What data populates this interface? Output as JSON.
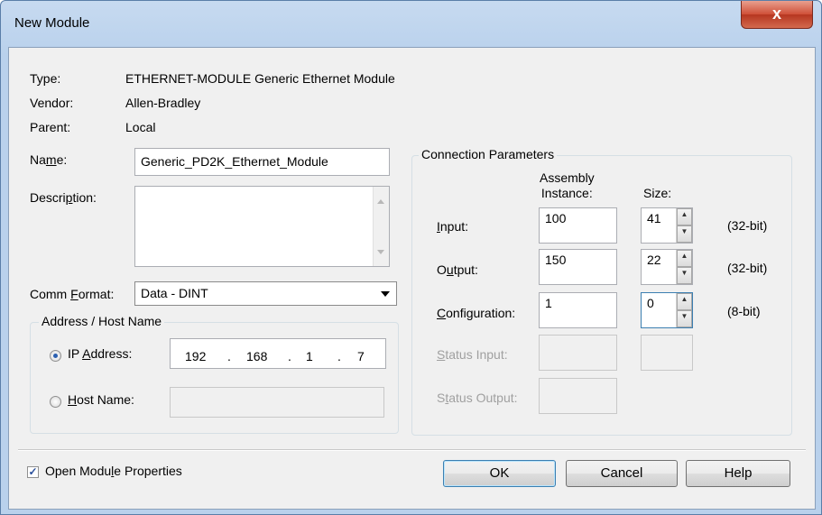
{
  "window": {
    "title": "New Module",
    "close_glyph": "x"
  },
  "fields": {
    "type_label": "Type:",
    "type_value": "ETHERNET-MODULE Generic Ethernet Module",
    "vendor_label": "Vendor:",
    "vendor_value": "Allen-Bradley",
    "parent_label": "Parent:",
    "parent_value": "Local",
    "name_label_pre": "Na",
    "name_label_u": "m",
    "name_label_post": "e:",
    "name_value": "Generic_PD2K_Ethernet_Module",
    "description_label_pre": "Descri",
    "description_label_u": "p",
    "description_label_post": "tion:",
    "description_value": "",
    "comm_format_label_pre": "Comm ",
    "comm_format_label_u": "F",
    "comm_format_label_post": "ormat:",
    "comm_format_value": "Data - DINT"
  },
  "address": {
    "group_title": "Address / Host Name",
    "ip_label_pre": "IP ",
    "ip_label_u": "A",
    "ip_label_post": "ddress:",
    "ip_octets": [
      "192",
      "168",
      "1",
      "7"
    ],
    "ip_dot": ".",
    "host_label_u": "H",
    "host_label_post": "ost Name:",
    "host_value": ""
  },
  "connection": {
    "group_title": "Connection Parameters",
    "assembly_header_line1": "Assembly",
    "assembly_header_line2": "Instance:",
    "size_header": "Size:",
    "input_label_u": "I",
    "input_label_post": "nput:",
    "input_instance": "100",
    "input_size": "41",
    "input_unit": "(32-bit)",
    "output_label_pre": "O",
    "output_label_u": "u",
    "output_label_post": "tput:",
    "output_instance": "150",
    "output_size": "22",
    "output_unit": "(32-bit)",
    "config_label_u": "C",
    "config_label_post": "onfiguration:",
    "config_instance": "1",
    "config_size": "0",
    "config_unit": "(8-bit)",
    "status_input_label_u": "S",
    "status_input_label_post": "tatus Input:",
    "status_output_label_pre": "S",
    "status_output_label_u": "t",
    "status_output_label_post": "atus Output:"
  },
  "footer": {
    "open_props_label_pre": "Open Modu",
    "open_props_label_u": "l",
    "open_props_label_post": "e Properties",
    "open_props_checked": true,
    "ok_label": "OK",
    "cancel_label": "Cancel",
    "help_label": "Help"
  }
}
